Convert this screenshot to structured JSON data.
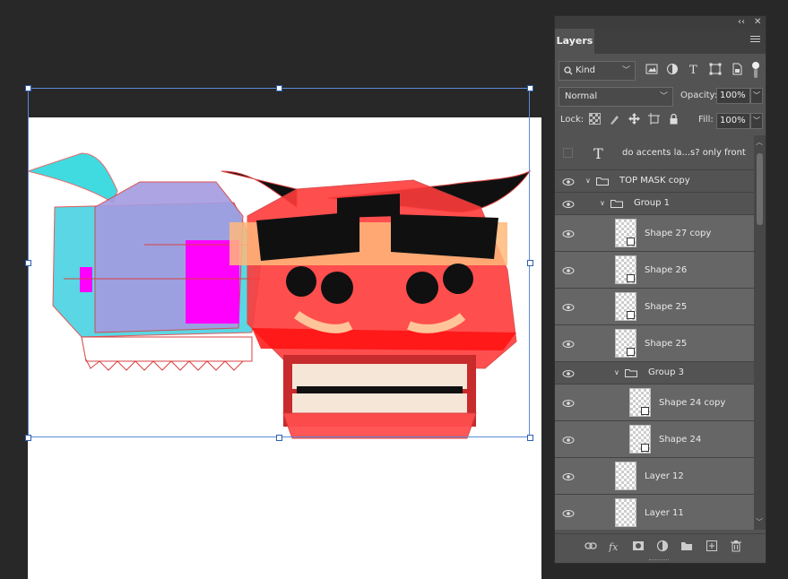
{
  "panel": {
    "collapse_glyph": "‹‹",
    "close_glyph": "✕",
    "tab_label": "Layers",
    "filter": {
      "label": "Kind"
    },
    "blend_mode": "Normal",
    "opacity_label": "Opacity:",
    "opacity_value": "100%",
    "lock_label": "Lock:",
    "fill_label": "Fill:",
    "fill_value": "100%"
  },
  "layers": [
    {
      "name": "do accents la...s? only front",
      "kind": "text",
      "visible": false
    },
    {
      "name": "TOP MASK copy",
      "kind": "group",
      "visible": true,
      "expanded": true
    },
    {
      "name": "Group 1",
      "kind": "group",
      "visible": true,
      "expanded": true
    },
    {
      "name": "Shape 27 copy",
      "kind": "shape",
      "visible": true
    },
    {
      "name": "Shape 26",
      "kind": "shape",
      "visible": true
    },
    {
      "name": "Shape 25",
      "kind": "shape",
      "visible": true
    },
    {
      "name": "Shape 25",
      "kind": "shape",
      "visible": true
    },
    {
      "name": "Group 3",
      "kind": "group",
      "visible": true,
      "expanded": true
    },
    {
      "name": "Shape 24 copy",
      "kind": "shape",
      "visible": true
    },
    {
      "name": "Shape 24",
      "kind": "shape",
      "visible": true
    },
    {
      "name": "Layer 12",
      "kind": "pixel",
      "visible": true
    },
    {
      "name": "Layer 11",
      "kind": "pixel",
      "visible": true
    }
  ],
  "icons": {
    "filter_icons": [
      "image-filter-icon",
      "adjustment-filter-icon",
      "type-filter-icon",
      "shape-filter-icon",
      "smart-object-filter-icon",
      "filter-toggle-icon"
    ],
    "lock_icons": [
      "lock-transparent-icon",
      "lock-pixels-icon",
      "lock-position-icon",
      "lock-artboard-icon",
      "lock-all-icon"
    ],
    "bottom_icons": [
      "link-layers-icon",
      "fx-icon",
      "add-mask-icon",
      "adjustment-layer-icon",
      "new-group-icon",
      "new-layer-icon",
      "delete-layer-icon"
    ]
  },
  "colors": {
    "panel_bg": "#535353",
    "canvas_bg": "#282828",
    "selection_border": "#5b8bd6",
    "highlight_row": "#666666"
  }
}
